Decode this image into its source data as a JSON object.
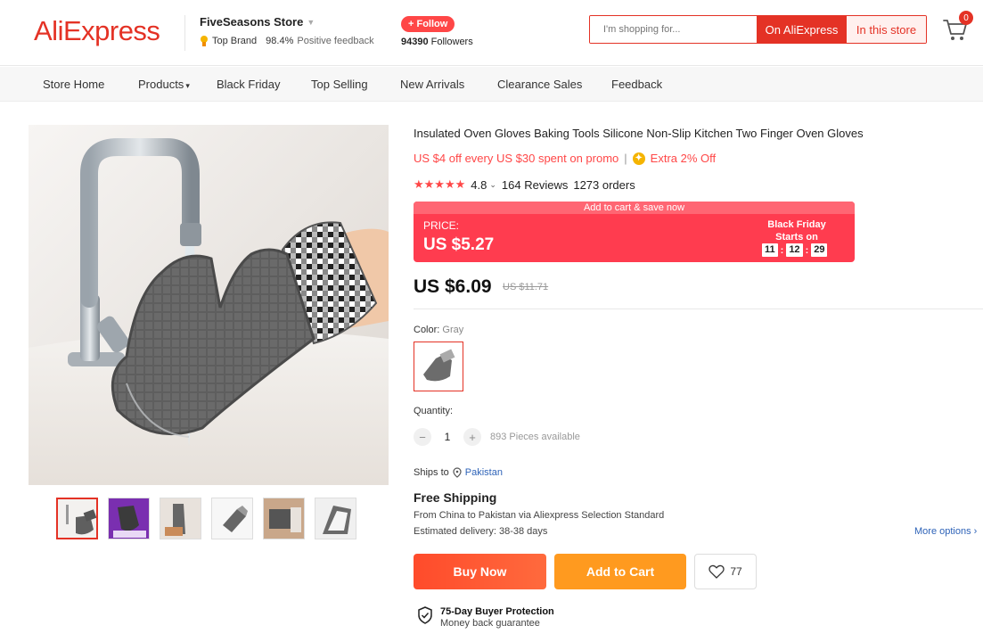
{
  "header": {
    "logo": "AliExpress",
    "store_name": "FiveSeasons Store",
    "top_brand": "Top Brand",
    "feedback_pct": "98.4%",
    "feedback_label": "Positive feedback",
    "follow_label": "+ Follow",
    "followers_count": "94390",
    "followers_label": "Followers",
    "search_placeholder": "I'm shopping for...",
    "search_on_aliexpress": "On AliExpress",
    "search_in_store": "In this store",
    "cart_count": "0"
  },
  "nav": {
    "items": [
      "Store Home",
      "Products",
      "Black Friday",
      "Top Selling",
      "New Arrivals",
      "Clearance Sales",
      "Feedback"
    ]
  },
  "product": {
    "title": "Insulated Oven Gloves Baking Tools Silicone Non-Slip Kitchen Two Finger Oven Gloves",
    "promo": "US $4 off every US $30 spent on promo",
    "promo_sep": "|",
    "extra_off": "Extra 2% Off",
    "stars": "★★★★★",
    "rating": "4.8",
    "reviews": "164 Reviews",
    "orders": "1273 orders",
    "banner_top": "Add to cart & save now",
    "price_label": "PRICE:",
    "banner_price": "US $5.27",
    "black_friday": "Black Friday",
    "starts_on": "Starts on",
    "countdown": [
      "11",
      "12",
      "29"
    ],
    "current_price": "US $6.09",
    "old_price": "US $11.71",
    "color_label": "Color:",
    "color_value": "Gray",
    "quantity_label": "Quantity:",
    "quantity_value": "1",
    "qty_minus": "−",
    "qty_plus": "+",
    "available": "893 Pieces available",
    "ships_to_label": "Ships to",
    "ships_to_country": "Pakistan",
    "free_shipping": "Free Shipping",
    "from_line": "From China to Pakistan via Aliexpress Selection Standard",
    "estimated": "Estimated delivery: 38-38 days",
    "more_options": "More options ›",
    "buy_now": "Buy Now",
    "add_to_cart": "Add to Cart",
    "wishlist_count": "77",
    "protection_title": "75-Day Buyer Protection",
    "protection_sub": "Money back guarantee"
  },
  "colors": {
    "brand": "#e43225",
    "price_banner": "#ff3c4f",
    "buy_now": "#ff4b2b",
    "add_to_cart": "#ff9a1f",
    "link": "#2e63b8"
  },
  "icons": [
    "cart-icon",
    "medal-icon",
    "dropdown-caret-icon",
    "coin-icon",
    "location-pin-icon",
    "heart-icon",
    "shield-check-icon"
  ]
}
